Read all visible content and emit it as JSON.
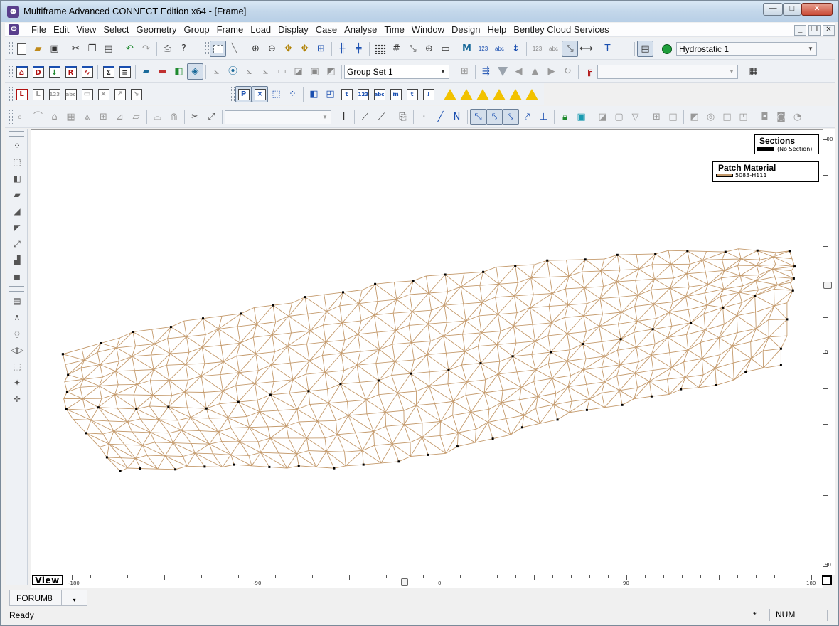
{
  "window": {
    "title": "Multiframe Advanced CONNECT Edition x64 - [Frame]",
    "buttons": {
      "minimize": "—",
      "maximize": "□",
      "close": "✕"
    }
  },
  "menu": {
    "items": [
      "File",
      "Edit",
      "View",
      "Select",
      "Geometry",
      "Group",
      "Frame",
      "Load",
      "Display",
      "Case",
      "Analyse",
      "Time",
      "Window",
      "Design",
      "Help",
      "Bentley Cloud Services"
    ],
    "mdi_buttons": [
      "_",
      "❐",
      "✕"
    ]
  },
  "toolbars": {
    "load_case": "Hydrostatic 1",
    "group_set": "Group Set 1",
    "empty_combo": "",
    "edit_combo": ""
  },
  "canvas": {
    "view_label": "View",
    "bottom_ruler_labels": [
      "-180",
      "-90",
      "0",
      "90",
      "180"
    ],
    "right_ruler_labels": [
      "-90",
      "0",
      "90"
    ]
  },
  "legends": {
    "sections": {
      "title": "Sections",
      "entry": "(No Section)",
      "color": "#000000"
    },
    "patch_material": {
      "title": "Patch Material",
      "entry": "5083-H111",
      "color": "#c49a6c"
    }
  },
  "tabs": {
    "active": "FORUM8",
    "dropdown": "▾"
  },
  "status": {
    "ready": "Ready",
    "modified": "*",
    "num": "NUM"
  },
  "colors": {
    "mesh": "#c49a6c",
    "node": "#000000",
    "accent": "#5a3f8c"
  }
}
